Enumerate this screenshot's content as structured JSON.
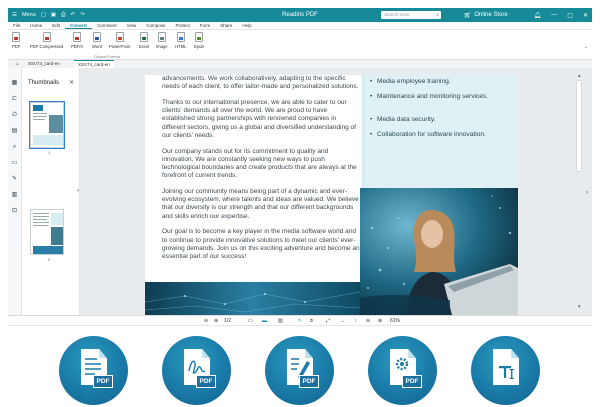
{
  "app": {
    "title": "Readiris PDF",
    "menu_label": "Menu",
    "search_placeholder": "Search tools",
    "online_store": "Online Store"
  },
  "menu_tabs": [
    "File",
    "Home",
    "Edit",
    "Convert",
    "Comment",
    "View",
    "Compose",
    "Protect",
    "Form",
    "Share",
    "Help"
  ],
  "active_menu_tab": "Convert",
  "ribbon": {
    "buttons": [
      {
        "label": "PDF",
        "color": "#c0392b"
      },
      {
        "label": "PDF Compressed",
        "color": "#c0392b"
      },
      {
        "label": "PDF/A",
        "color": "#c0392b"
      },
      {
        "label": "Word",
        "color": "#2b5797"
      },
      {
        "label": "PowerPoint",
        "color": "#d24726"
      },
      {
        "label": "Excel",
        "color": "#1e7145"
      },
      {
        "label": "Image",
        "color": "#6b7b84"
      },
      {
        "label": "HTML",
        "color": "#2b7fd0"
      },
      {
        "label": "Epub",
        "color": "#5a8f2a"
      }
    ],
    "group_label": "Output Format"
  },
  "doc_tabs": [
    "XSV74_card-en",
    "XSV74_card-en"
  ],
  "thumbnails": {
    "title": "Thumbnails",
    "page_numbers": [
      "1",
      "2"
    ]
  },
  "document": {
    "paragraphs": [
      "advancements. We work collaboratively, adapting to the specific needs of each client, to offer tailor-made and personalized solutions.",
      "Thanks to our international presence, we are able to cater to our clients' demands all over the world. We are proud to have established strong partnerships with renowned companies in different sectors, giving us a global and diversified understanding of our clients' needs.",
      "Our company stands out for its commitment to quality and innovation. We are constantly seeking new ways to push technological boundaries and create products that are always at the forefront of current trends.",
      "Joining our community means being part of a dynamic and ever-evolving ecosystem, where talents and ideas are valued. We believe that our diversity is our strength and that our different backgrounds and skills enrich our expertise.",
      "Our goal is to become a key player in the media software world and to continue to provide innovative solutions to meet our clients' ever-growing demands. Join us on this exciting adventure and become an essential part of our success!"
    ],
    "bullets": [
      "Media employee training.",
      "Maintenance and monitoring services.",
      "Media data security.",
      "Collaboration for software innovation."
    ]
  },
  "status": {
    "page_indicator": "1/2",
    "zoom": "61%"
  },
  "feature_icons": [
    {
      "name": "pdf-document",
      "badge": "PDF"
    },
    {
      "name": "pdf-signature",
      "badge": "PDF"
    },
    {
      "name": "pdf-edit",
      "badge": "PDF"
    },
    {
      "name": "pdf-settings",
      "badge": "PDF"
    },
    {
      "name": "text-edit",
      "badge": ""
    }
  ],
  "colors": {
    "brand": "#168a99",
    "accent_blue": "#1a7aa8",
    "panel_light": "#dff1f4"
  }
}
